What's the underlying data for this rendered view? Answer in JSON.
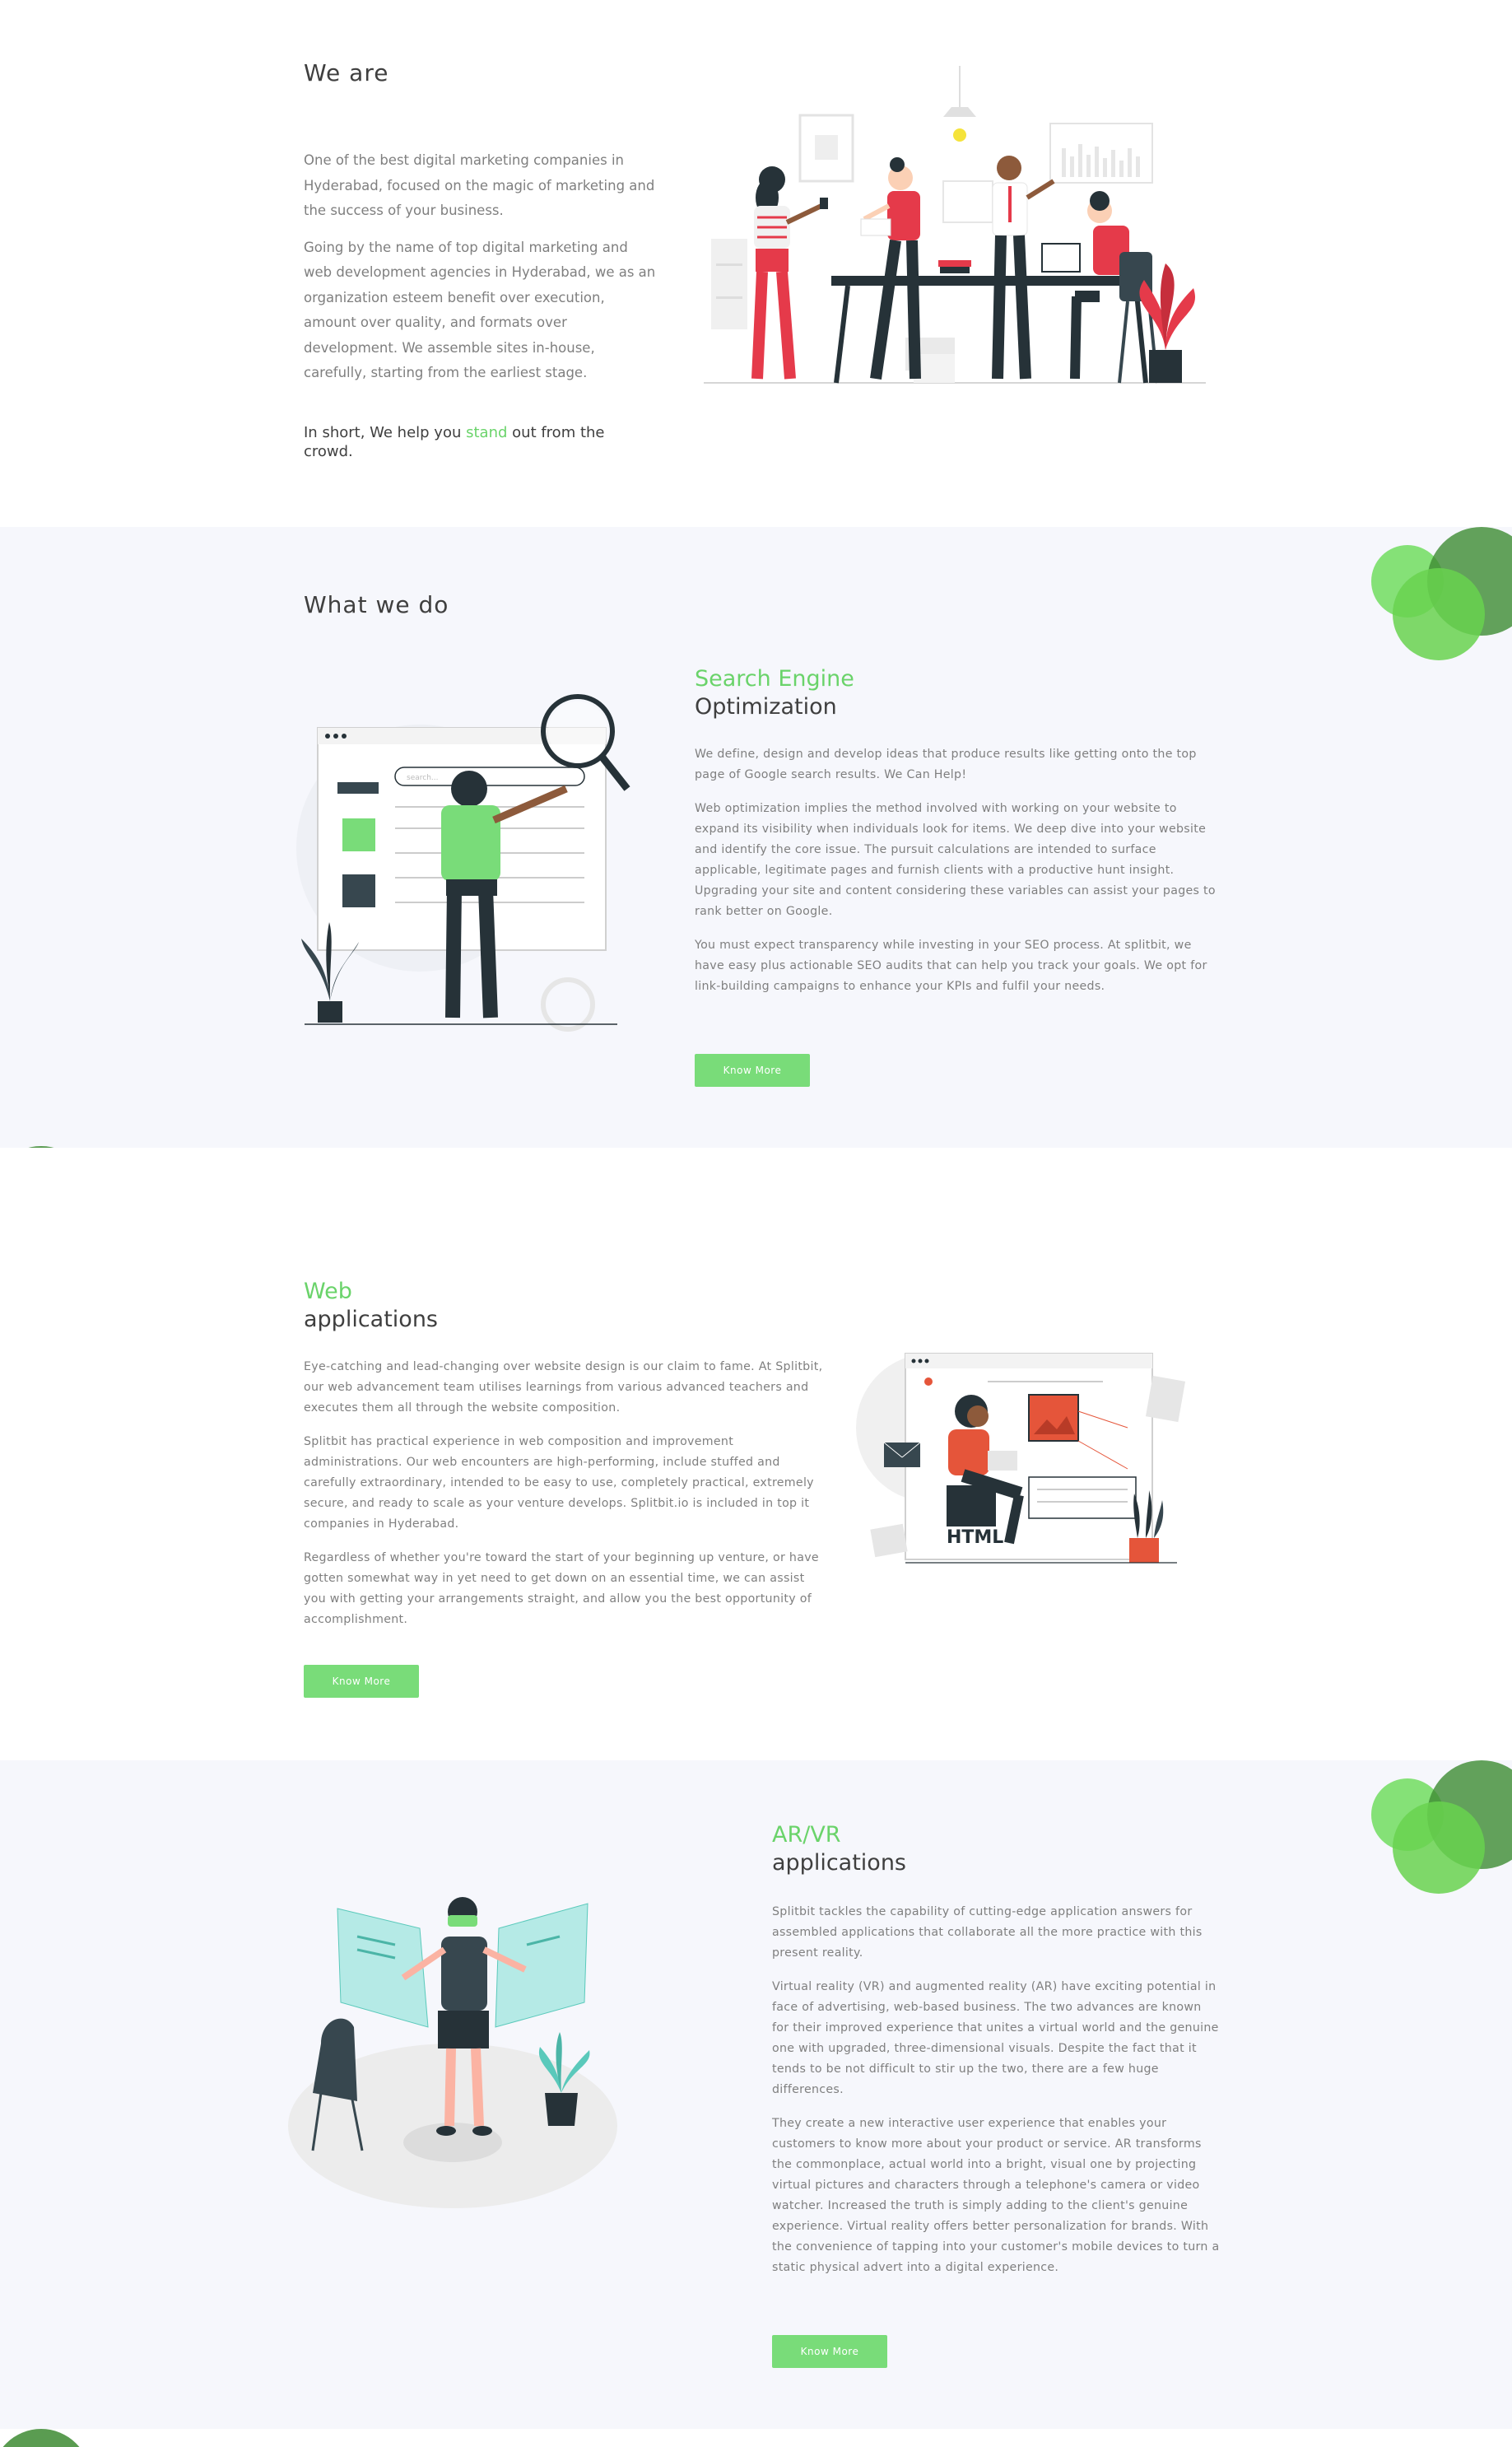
{
  "about": {
    "heading": "We are",
    "paragraphs": [
      "One of the best digital marketing companies in Hyderabad, focused on the magic of marketing and the success of your business.",
      "Going by the name of top digital marketing and web development agencies in Hyderabad, we as an organization esteem benefit over execution, amount over quality, and formats over development. We assemble sites in-house, carefully, starting from the earliest stage."
    ],
    "tagline_prefix": "In short, We help you ",
    "tagline_highlight": "stand",
    "tagline_suffix": " out from the crowd."
  },
  "services": {
    "heading": "What we do",
    "seo": {
      "title_green": "Search Engine",
      "title_dark": "Optimization",
      "paragraphs": [
        "We define, design and develop ideas that produce results like getting onto the top page of Google search results. We Can Help!",
        "Web optimization implies the method involved with working on your website to expand its visibility when individuals look for items. We deep dive into your website and identify the core issue. The pursuit calculations are intended to surface applicable, legitimate pages and furnish clients with a productive hunt insight. Upgrading your site and content considering these variables can assist your pages to rank better on Google.",
        "You must expect transparency while investing in your SEO process. At splitbit, we have easy plus actionable SEO audits that can help you track your goals. We opt for link-building campaigns to enhance your KPIs and fulfil your needs."
      ],
      "button": "Know More",
      "illustration_search_text": "search..."
    },
    "web": {
      "title_green": "Web",
      "title_dark": "applications",
      "paragraphs": [
        "Eye-catching and lead-changing over website design is our claim to fame. At Splitbit, our web advancement team utilises learnings from various advanced teachers and executes them all through the website composition.",
        "Splitbit has practical experience in web composition and improvement administrations. Our web encounters are high-performing, include stuffed and carefully extraordinary, intended to be easy to use, completely practical, extremely secure, and ready to scale as your venture develops. Splitbit.io is included in top it companies in Hyderabad.",
        "Regardless of whether you're toward the start of your beginning up venture, or have gotten somewhat way in yet need to get down on an essential time, we can assist you with getting your arrangements straight, and allow you the best opportunity of accomplishment."
      ],
      "button": "Know More",
      "illustration_label": "HTML"
    },
    "arvr": {
      "title_green": "AR/VR",
      "title_dark": "applications",
      "paragraphs": [
        "Splitbit tackles the capability of cutting-edge application answers for assembled applications that collaborate all the more practice with this present reality.",
        "Virtual reality (VR) and augmented reality (AR) have exciting potential in face of advertising, web-based business. The two advances are known for their improved experience that unites a virtual world and the genuine one with upgraded, three-dimensional visuals. Despite the fact that it tends to be not difficult to stir up the two, there are a few huge differences.",
        "They create a new interactive user experience that enables your customers to know more about your product or service. AR transforms the commonplace, actual world into a bright, visual one by projecting virtual pictures and characters through a telephone's camera or video watcher. Increased the truth is simply adding to the client's genuine experience. Virtual reality offers better personalization for brands. With the convenience of tapping into your customer's mobile devices to turn a static physical advert into a digital experience."
      ],
      "button": "Know More"
    }
  },
  "colors": {
    "accent_green": "#6ad36a",
    "button_green": "#79dc79",
    "section_grey": "#f6f7fc",
    "heading": "#3f3f3f",
    "body_text": "#7f7f7f",
    "illustration_red": "#e53a4a",
    "illustration_dark": "#263238"
  }
}
